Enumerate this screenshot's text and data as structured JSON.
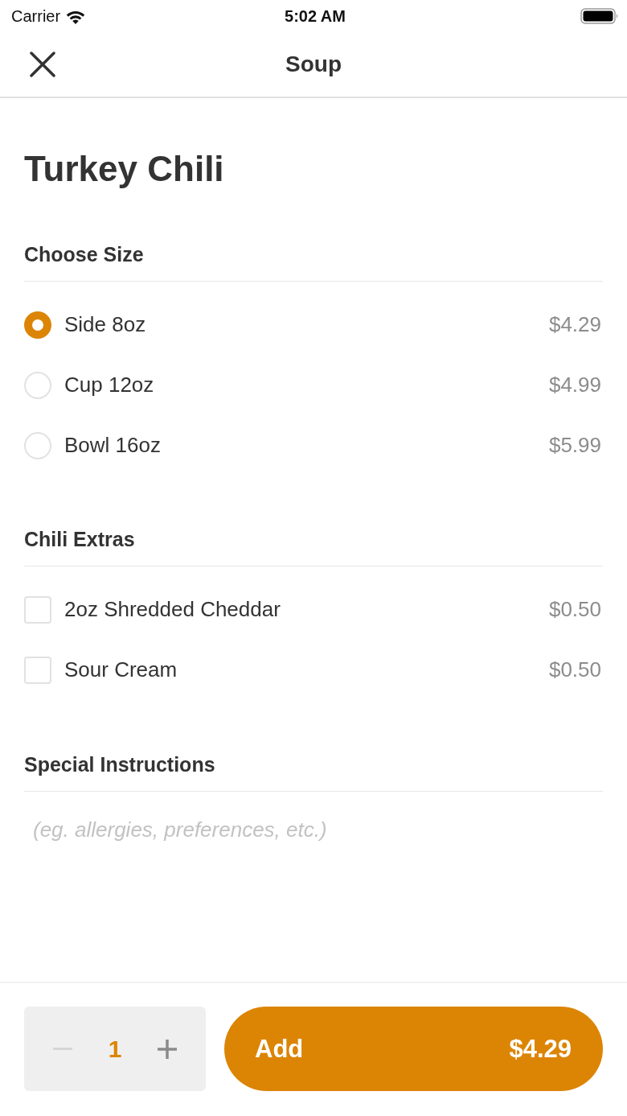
{
  "status_bar": {
    "carrier": "Carrier",
    "time": "5:02 AM"
  },
  "nav_bar": {
    "title": "Soup"
  },
  "item": {
    "name": "Turkey Chili"
  },
  "sections": [
    {
      "kind": "radio",
      "title": "Choose Size",
      "options": [
        {
          "label": "Side 8oz",
          "price": "$4.29",
          "selected": true
        },
        {
          "label": "Cup 12oz",
          "price": "$4.99",
          "selected": false
        },
        {
          "label": "Bowl 16oz",
          "price": "$5.99",
          "selected": false
        }
      ]
    },
    {
      "kind": "checkbox",
      "title": "Chili Extras",
      "options": [
        {
          "label": "2oz Shredded Cheddar",
          "price": "$0.50",
          "checked": false
        },
        {
          "label": "Sour Cream",
          "price": "$0.50",
          "checked": false
        }
      ]
    }
  ],
  "special_instructions": {
    "title": "Special Instructions",
    "placeholder": "(eg. allergies, preferences, etc.)"
  },
  "footer": {
    "quantity": "1",
    "decrement_disabled": true,
    "add_label": "Add",
    "total": "$4.29"
  }
}
